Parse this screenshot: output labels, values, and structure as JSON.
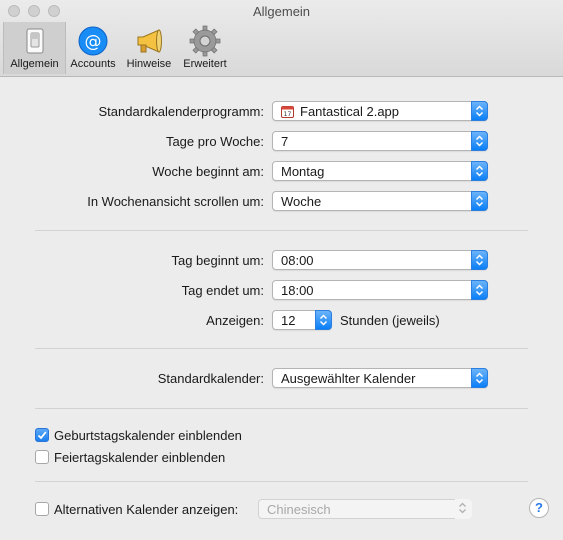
{
  "window": {
    "title": "Allgemein"
  },
  "toolbar": {
    "items": [
      {
        "label": "Allgemein",
        "icon": "switch-icon",
        "active": true
      },
      {
        "label": "Accounts",
        "icon": "at-sign-icon",
        "active": false
      },
      {
        "label": "Hinweise",
        "icon": "megaphone-icon",
        "active": false
      },
      {
        "label": "Erweitert",
        "icon": "gear-icon",
        "active": false
      }
    ]
  },
  "general": {
    "default_app": {
      "label": "Standardkalenderprogramm:",
      "value": "Fantastical 2.app",
      "icon": "calendar-app-icon"
    },
    "days_per_week": {
      "label": "Tage pro Woche:",
      "value": "7"
    },
    "week_start": {
      "label": "Woche beginnt am:",
      "value": "Montag"
    },
    "week_scroll": {
      "label": "In Wochenansicht scrollen um:",
      "value": "Woche"
    }
  },
  "day": {
    "day_start": {
      "label": "Tag beginnt um:",
      "value": "08:00"
    },
    "day_end": {
      "label": "Tag endet um:",
      "value": "18:00"
    },
    "show": {
      "label": "Anzeigen:",
      "value": "12",
      "suffix": "Stunden (jeweils)"
    }
  },
  "default_calendar": {
    "label": "Standardkalender:",
    "value": "Ausgewählter Kalender"
  },
  "checkboxes": {
    "birthdays": {
      "label": "Geburtstagskalender einblenden",
      "checked": true
    },
    "holidays": {
      "label": "Feiertagskalender einblenden",
      "checked": false
    }
  },
  "alternative": {
    "label": "Alternativen Kalender anzeigen:",
    "checked": false,
    "value": "Chinesisch",
    "enabled": false
  },
  "help": {
    "label": "?"
  },
  "colors": {
    "accent": "#1b7ff0",
    "background": "#ececec"
  }
}
